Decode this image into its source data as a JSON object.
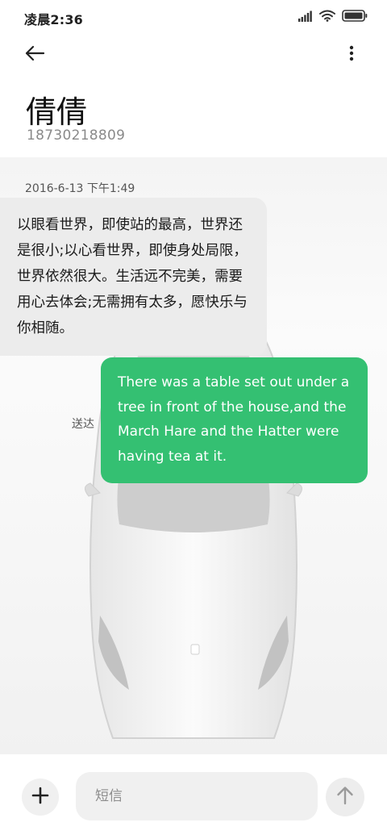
{
  "status_bar": {
    "time": "凌晨2:36"
  },
  "header": {
    "back_icon": "arrow-left-icon",
    "more_icon": "more-vertical-icon"
  },
  "contact": {
    "name": "倩倩",
    "number": "18730218809"
  },
  "conversation": {
    "timestamp": "2016-6-13 下午1:49",
    "received_message": "以眼看世界，即使站的最高，世界还是很小;以心看世界，即使身处局限，世界依然很大。生活远不完美，需要用心去体会;无需拥有太多，愿快乐与你相随。",
    "sent_message": "There was a table set out under a tree in front of the house,and the March Hare and the Hatter were having tea at it.",
    "sent_status": "送达",
    "sent_bubble_color": "#34c072"
  },
  "composer": {
    "placeholder": "短信",
    "add_icon": "plus-icon",
    "send_icon": "arrow-up-icon"
  }
}
